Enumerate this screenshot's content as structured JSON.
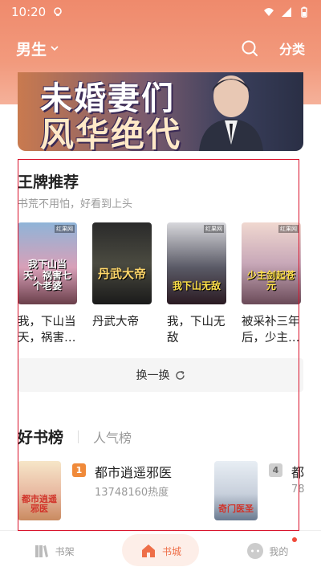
{
  "status_bar": {
    "time": "10:20"
  },
  "header": {
    "channel": "男生",
    "classify_label": "分类"
  },
  "banner": {
    "title_line1": "未婚妻们",
    "title_line2": "风华绝代"
  },
  "recommend": {
    "title": "王牌推荐",
    "subtitle": "书荒不用怕，好看到上头",
    "books": [
      {
        "name": "我，下山当天，祸害…",
        "cover_text": "我下山当天，祸害七个老婆",
        "cover_tag": "红果网"
      },
      {
        "name": "丹武大帝",
        "cover_text": "丹武大帝",
        "cover_tag": ""
      },
      {
        "name": "我，下山无敌",
        "cover_text": "我下山无敌",
        "cover_tag": "红果网"
      },
      {
        "name": "被采补三年后，少主…",
        "cover_text": "少主剑起苍元",
        "cover_tag": "红果网"
      }
    ],
    "refresh_label": "换一换"
  },
  "ranking": {
    "active_tab": "好书榜",
    "other_tab": "人气榜",
    "items": [
      {
        "rank": "1",
        "name": "都市逍遥邪医",
        "heat": "13748160热度",
        "cover_text": "都市逍遥邪医"
      },
      {
        "rank": "4",
        "name": "都",
        "heat": "78",
        "cover_text": "奇门医圣"
      }
    ]
  },
  "bottom_nav": {
    "items": [
      {
        "label": "书架",
        "icon": "bookshelf-icon"
      },
      {
        "label": "书城",
        "icon": "home-icon"
      },
      {
        "label": "我的",
        "icon": "profile-icon"
      }
    ]
  },
  "colors": {
    "accent": "#ee6e48",
    "header_bg": "#ef8a6c",
    "rank1": "#f08a3a",
    "rank4": "#cfcfcf",
    "annotation": "#d9122b"
  }
}
